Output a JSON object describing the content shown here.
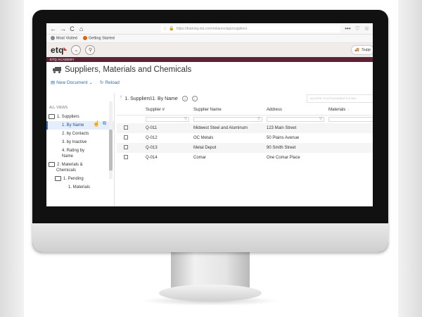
{
  "browser": {
    "back": "←",
    "forward": "→",
    "reload": "C",
    "home": "⌂",
    "url": "https://training.etq.com/reliance/app/suppliers",
    "menu_icon": "•••",
    "bookmarks": [
      "Most Visited",
      "Getting Started"
    ]
  },
  "app": {
    "logo_text": "etq",
    "academy_label": "ETQ ACADEMY",
    "user_label": "Supp",
    "page_title": "Suppliers, Materials and Chemicals",
    "toolbar": {
      "new_document": "New Document",
      "reload": "Reload"
    }
  },
  "sidebar": {
    "header": "ALL VIEWS",
    "items": [
      {
        "label": "1. Suppliers",
        "level": 1,
        "folder": true
      },
      {
        "label": "1. By Name",
        "level": 2,
        "selected": true
      },
      {
        "label": "2. by Contacts",
        "level": 2
      },
      {
        "label": "3. by Inactive",
        "level": 2
      },
      {
        "label": "4. Rating by",
        "level": 2
      },
      {
        "label": "Name",
        "level": 2
      },
      {
        "label": "2. Materials &",
        "level": 1,
        "folder": true
      },
      {
        "label": "Chemicals",
        "level": 1
      },
      {
        "label": "1. Pending",
        "level": 2,
        "folder": true
      },
      {
        "label": "1. Materials",
        "level": 3
      }
    ]
  },
  "main": {
    "breadcrumb": "1. Suppliers\\1. By Name",
    "search_placeholder": "ACCESS TO ATTACHMENTS & REL",
    "columns": [
      "Supplier #",
      "Supplier Name",
      "Address",
      "Materials"
    ],
    "rows": [
      [
        "Q-011",
        "Midwest Steel and Aluminum",
        "123 Main Street",
        ""
      ],
      [
        "Q-012",
        "OC Metals",
        "50 Plains Avenue",
        ""
      ],
      [
        "Q-013",
        "Metal Depot",
        "90 Smith Street",
        ""
      ],
      [
        "Q-014",
        "Comar",
        "One Comar Place",
        ""
      ]
    ]
  },
  "colors": {
    "academy_bar": "#5b2334",
    "link": "#2d6fb3",
    "logo_accent": "#c0392b"
  }
}
